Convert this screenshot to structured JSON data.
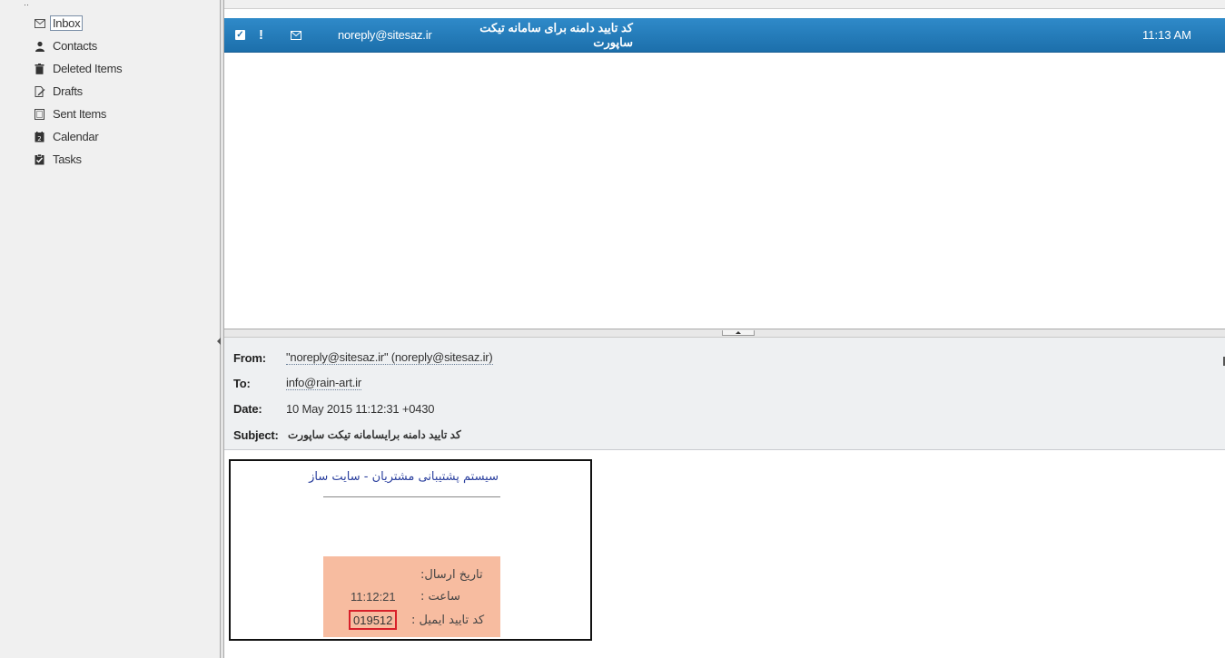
{
  "sidebar": {
    "folders": [
      {
        "label": "Inbox",
        "icon": "envelope-icon",
        "selected": true
      },
      {
        "label": "Contacts",
        "icon": "person-icon"
      },
      {
        "label": "Deleted Items",
        "icon": "trash-icon"
      },
      {
        "label": "Drafts",
        "icon": "draft-icon"
      },
      {
        "label": "Sent Items",
        "icon": "sent-icon"
      },
      {
        "label": "Calendar",
        "icon": "calendar-icon"
      },
      {
        "label": "Tasks",
        "icon": "tasks-icon"
      }
    ]
  },
  "message_list": {
    "rows": [
      {
        "checked": true,
        "important": "!",
        "from": "noreply@sitesaz.ir",
        "subject": "کد تایید دامنه برای سامانه تیکت ساپورت",
        "time": "11:13 AM",
        "selected": true
      }
    ]
  },
  "header": {
    "from_label": "From:",
    "from_value": "\"noreply@sitesaz.ir\" (noreply@sitesaz.ir)",
    "to_label": "To:",
    "to_value": "info@rain-art.ir",
    "date_label": "Date:",
    "date_value": "10 May 2015 11:12:31 +0430",
    "subject_label": "Subject:",
    "subject_value": "کد تایید دامنه برایسامانه تیکت ساپورت"
  },
  "body": {
    "title": "سیستم پشتیبانی مشتریان - سایت ساز",
    "send_date_label": "تاریخ ارسال:",
    "send_time_label": "ساعت :",
    "send_time_value": "11:12:21",
    "code_label": "کد تایید ایمیل :",
    "code_value": "019512"
  },
  "colors": {
    "selection_blue": "#1c6fab",
    "info_box": "#f7bca0",
    "code_highlight": "#d8202a",
    "title_blue": "#2a3f9e"
  }
}
